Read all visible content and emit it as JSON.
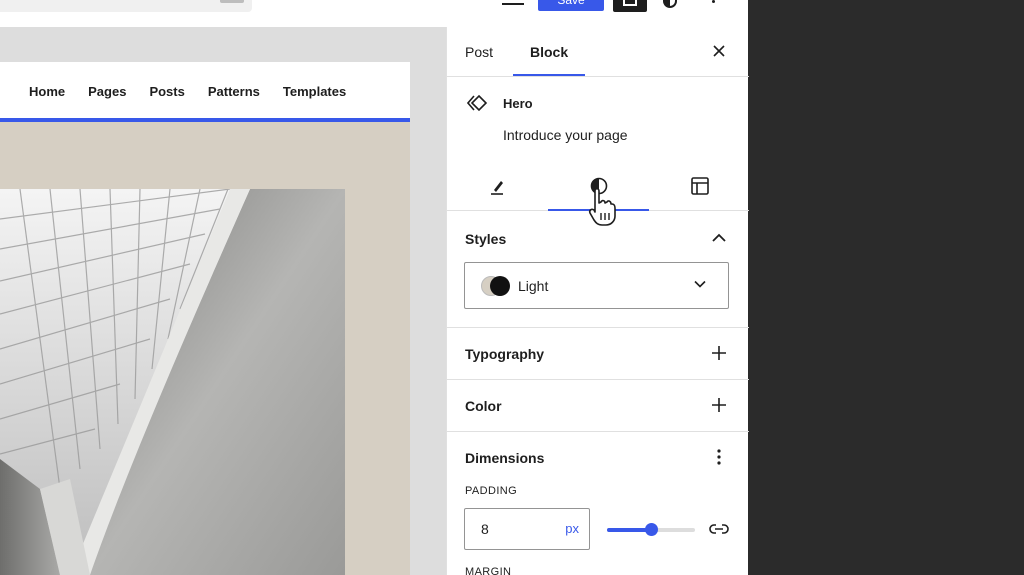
{
  "toolbar": {
    "save_label": "Save"
  },
  "site": {
    "nav": [
      "Home",
      "Pages",
      "Posts",
      "Patterns",
      "Templates"
    ]
  },
  "sidebar": {
    "tabs": [
      {
        "label": "Post"
      },
      {
        "label": "Block"
      }
    ],
    "block": {
      "name": "Hero",
      "description": "Introduce your page"
    },
    "subtabs": [
      "settings",
      "styles",
      "layout"
    ],
    "styles_panel": {
      "title": "Styles",
      "selected": "Light"
    },
    "typography_panel": {
      "title": "Typography"
    },
    "color_panel": {
      "title": "Color"
    },
    "dimensions_panel": {
      "title": "Dimensions",
      "padding_label": "PADDING",
      "padding_value": "8",
      "padding_unit": "px",
      "padding_slider_fraction": 0.5,
      "margin_label": "MARGIN"
    }
  },
  "colors": {
    "accent": "#3858e9",
    "hero_background": "#d6cfc3",
    "editor_canvas": "#dddddd"
  }
}
